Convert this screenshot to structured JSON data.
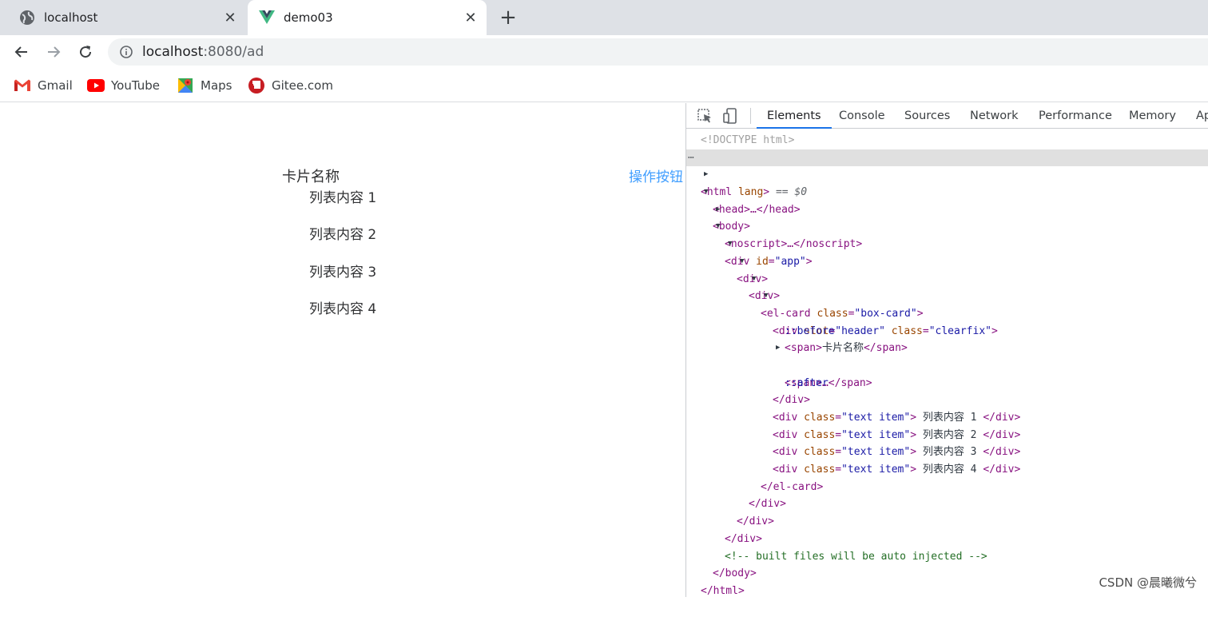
{
  "browser": {
    "tabs": [
      {
        "title": "localhost",
        "icon": "globe-icon"
      },
      {
        "title": "demo03",
        "icon": "vue-logo-icon"
      }
    ],
    "new_tab": "+",
    "url": {
      "host": "localhost",
      "rest": ":8080/ad"
    },
    "bookmarks": [
      {
        "label": "Gmail",
        "icon": "gmail-icon"
      },
      {
        "label": "YouTube",
        "icon": "youtube-icon"
      },
      {
        "label": "Maps",
        "icon": "maps-icon"
      },
      {
        "label": "Gitee.com",
        "icon": "gitee-icon"
      }
    ]
  },
  "page": {
    "card_title": "卡片名称",
    "action_button": "操作按钮",
    "items": [
      "列表内容 1",
      "列表内容 2",
      "列表内容 3",
      "列表内容 4"
    ]
  },
  "devtools": {
    "tabs": [
      "Elements",
      "Console",
      "Sources",
      "Network",
      "Performance",
      "Memory",
      "Ap"
    ],
    "active_tab": "Elements",
    "dom": {
      "doctype": "<!DOCTYPE html>",
      "html_open": "<html",
      "html_attr": "lang",
      "html_close_bracket": ">",
      "selected_marker": "== $0",
      "head": "<head>…</head>",
      "body_open": "<body>",
      "noscript": "<noscript>…</noscript>",
      "div_app_open": "<div",
      "div_app_attr": "id",
      "div_app_val": "\"app\"",
      "div_open": "<div>",
      "elcard_open": "<el-card",
      "elcard_attr": "class",
      "elcard_val": "\"box-card\"",
      "header_div_open": "<div",
      "slot_attr": "slot",
      "slot_val": "\"header\"",
      "class_attr": "class",
      "clearfix_val": "\"clearfix\"",
      "before": "::before",
      "span_open": "<span>",
      "span_text": "卡片名称",
      "span_close": "</span>",
      "span_collapsed": "<span>…</span>",
      "after": "::after",
      "div_close": "</div>",
      "item_div_open": "<div",
      "item_class_val": "\"text item\"",
      "item_texts": [
        " 列表内容 1 ",
        " 列表内容 2 ",
        " 列表内容 3 ",
        " 列表内容 4 "
      ],
      "elcard_close": "</el-card>",
      "comment": "<!-- built files will be auto injected -->",
      "body_close": "</body>",
      "html_close": "</html>"
    }
  },
  "watermark": "CSDN @晨曦微兮"
}
